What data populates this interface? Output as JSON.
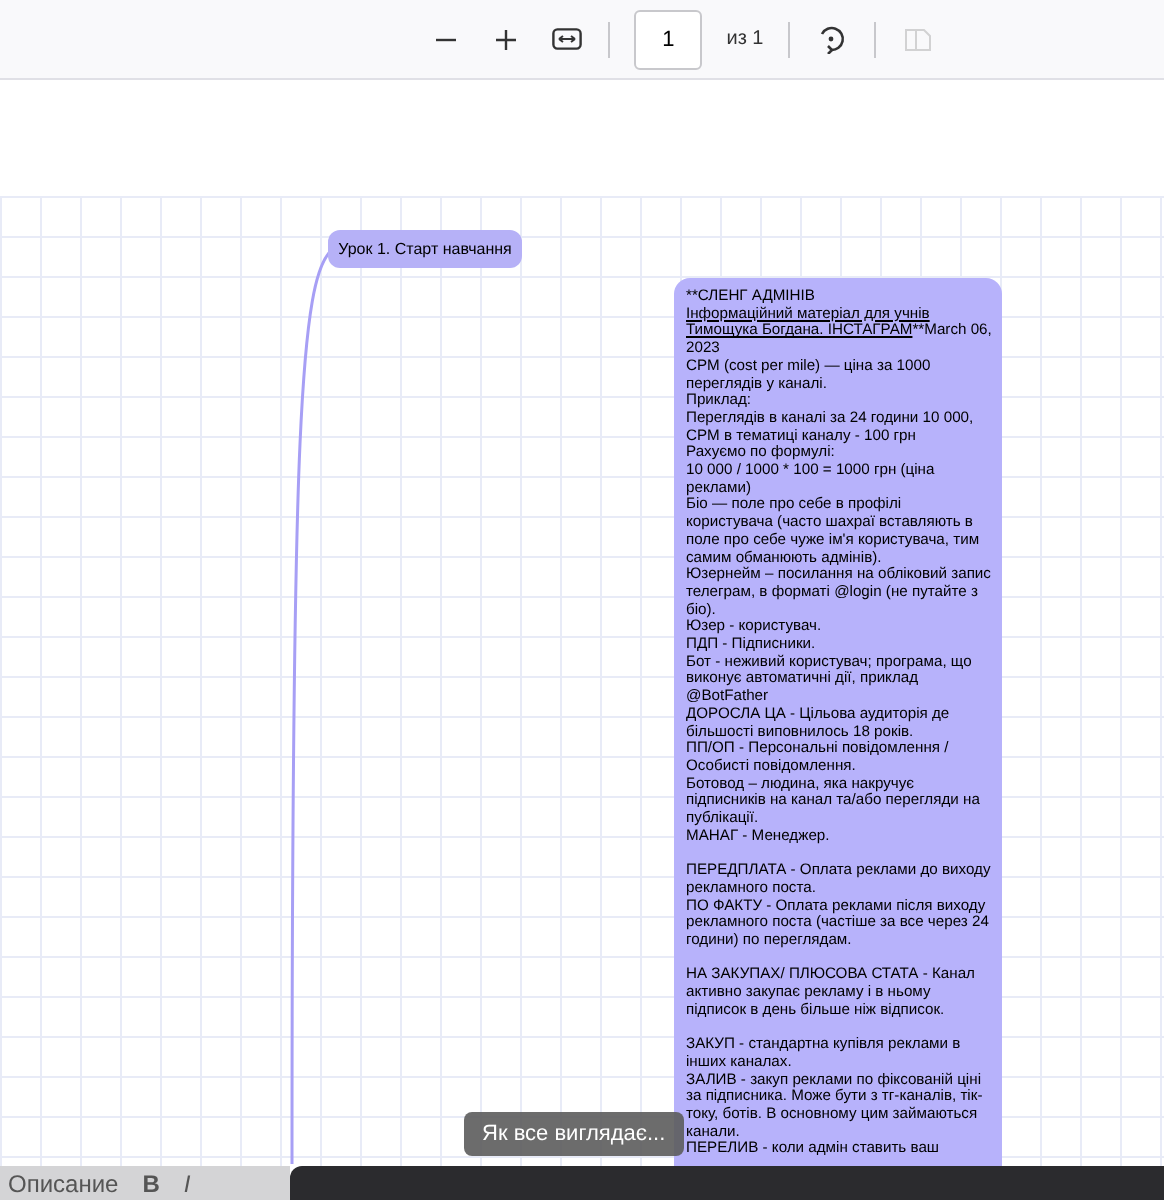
{
  "toolbar": {
    "buttons": [
      {
        "kind": "zoom-out",
        "disabled": false
      },
      {
        "kind": "zoom-in",
        "disabled": false
      },
      {
        "kind": "fit-width",
        "disabled": false
      },
      {
        "kind": "page",
        "value": "1",
        "total": "из 1"
      },
      {
        "kind": "rotate",
        "disabled": false
      },
      {
        "kind": "spread",
        "disabled": true
      }
    ]
  },
  "mind_map": {
    "node": {
      "label": "Урок 1. Старт навчання"
    },
    "note": {
      "heading": {
        "prefix": "**СЛЕНГ АДМІНІВ",
        "underlined": "Інформаційний матеріал для учнів Тимощука Богдана. ІНСТАГРАМ",
        "suffix": "**March 06, 2023"
      },
      "sections": [
        [
          "CPM (cost per mile) — ціна за 1000 переглядів у каналі.",
          "Приклад:",
          "Переглядів в каналі за 24 години 10 000, CPM в тематиці каналу - 100 грн",
          "Рахуємо по формулі:",
          "10 000 / 1000 * 100 = 1000 грн (ціна реклами)",
          "Біо — поле про себе в профілі користувача (часто шахраї вставляють в поле про себе чуже ім'я користувача, тим самим обманюють адмінів).",
          "Юзернейм – посилання на обліковий запис телеграм, в форматі @login (не путайте з біо).",
          "Юзер - користувач.",
          "ПДП - Підписники.",
          "Бот - неживий користувач; програма, що виконує автоматичні дії, приклад @BotFather",
          "ДОРОСЛА ЦА - Цільова аудиторія де більшості виповнилось 18 років.",
          "ПП/ОП - Персональні повідомлення / Особисті повідомлення.",
          "Ботовод – людина, яка накручує підписників на канал та/або перегляди на публікації.",
          "МАНАГ - Менеджер."
        ],
        [
          "ПЕРЕДПЛАТА - Оплата реклами до виходу рекламного поста.",
          "ПО ФАКТУ - Оплата реклами після виходу рекламного поста (частіше за все через 24 години) по переглядам."
        ],
        [
          "НА ЗАКУПАХ/ ПЛЮСОВА СТАТА - Канал активно закупає рекламу і в ньому підписок в день більше ніж відписок."
        ],
        [
          "ЗАКУП - стандартна купівля реклами в інших каналах.",
          "ЗАЛИВ - закуп реклами по фіксованій ціні за підписника. Може бути з тг-каналів, тік-току, ботів. В основному цим займаються канали.",
          "ПЕРЕЛИВ - коли адмін ставить ваш"
        ]
      ]
    }
  },
  "tooltip": {
    "text": "Як все виглядає..."
  },
  "bottom_bar": {
    "label": "Описание",
    "format_buttons": [
      "B",
      "I"
    ]
  }
}
